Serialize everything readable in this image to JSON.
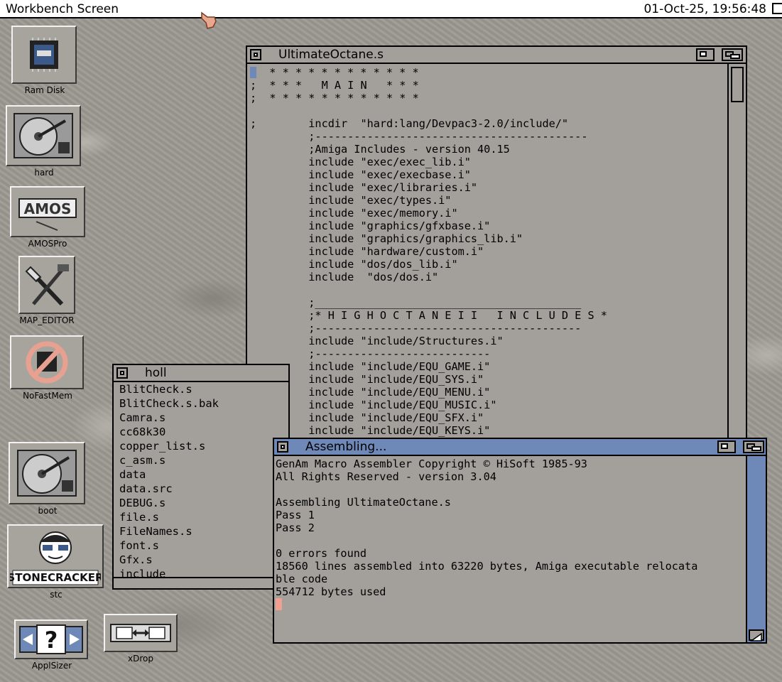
{
  "screen": {
    "title": "Workbench Screen",
    "clock": "01-Oct-25, 19:56:48"
  },
  "desktop_icons": [
    {
      "name": "Ram Disk"
    },
    {
      "name": "hard"
    },
    {
      "name": "AMOSPro"
    },
    {
      "name": "MAP_EDITOR"
    },
    {
      "name": "NoFastMem"
    },
    {
      "name": "boot"
    },
    {
      "name": "stc"
    },
    {
      "name": "ApplSizer"
    },
    {
      "name": "xDrop"
    }
  ],
  "stonecracker_banner": "STONECRACKER",
  "amos_logo_text": "AMOS",
  "editor_window": {
    "title": "UltimateOctane.s",
    "lines": [
      ";  * * * * * * * * * * * *",
      ";  * * *   M A I N   * * *",
      ";  * * * * * * * * * * * *",
      "",
      ";        incdir  \"hard:lang/Devpac3-2.0/include/\"",
      "         ;------------------------------------------",
      "         ;Amiga Includes - version 40.15",
      "         include \"exec/exec_lib.i\"",
      "         include \"exec/execbase.i\"",
      "         include \"exec/libraries.i\"",
      "         include \"exec/types.i\"",
      "         include \"exec/memory.i\"",
      "         include \"graphics/gfxbase.i\"",
      "         include \"graphics/graphics_lib.i\"",
      "         include \"hardware/custom.i\"",
      "         include \"dos/dos_lib.i\"",
      "         include  \"dos/dos.i\"",
      "",
      "         ;_________________________________________",
      "         ;* H I G H O C T A N E I I   I N C L U D E S *",
      "         ;-----------------------------------------",
      "         include \"include/Structures.i\"",
      "         ;---------------------------",
      "         include \"include/EQU_GAME.i\"",
      "         include \"include/EQU_SYS.i\"",
      "         include \"include/EQU_MENU.i\"",
      "         include \"include/EQU_MUSIC.i\"",
      "         include \"include/EQU_SFX.i\"",
      "         include \"include/EQU_KEYS.i\""
    ]
  },
  "drawer_window": {
    "title": "holl",
    "files": [
      "BlitCheck.s",
      "BlitCheck.s.bak",
      "Camra.s",
      "cc68k30",
      "copper_list.s",
      "c_asm.s",
      "data",
      "data.src",
      "DEBUG.s",
      "file.s",
      "FileNames.s",
      "font.s",
      "Gfx.s",
      "include"
    ]
  },
  "assemble_window": {
    "title": "Assembling...",
    "lines": [
      "GenAm Macro Assembler Copyright © HiSoft 1985-93",
      "All Rights Reserved - version 3.04",
      "",
      "Assembling UltimateOctane.s",
      "Pass 1",
      "Pass 2",
      "",
      "0 errors found",
      "18560 lines assembled into 63220 bytes, Amiga executable relocata",
      "ble code",
      "554712 bytes used"
    ]
  },
  "colors": {
    "active_titlebar": "#6e88b8",
    "window_bg": "#a3a09c",
    "cursor": "#f0a090",
    "screen_bar": "#ffffff"
  }
}
